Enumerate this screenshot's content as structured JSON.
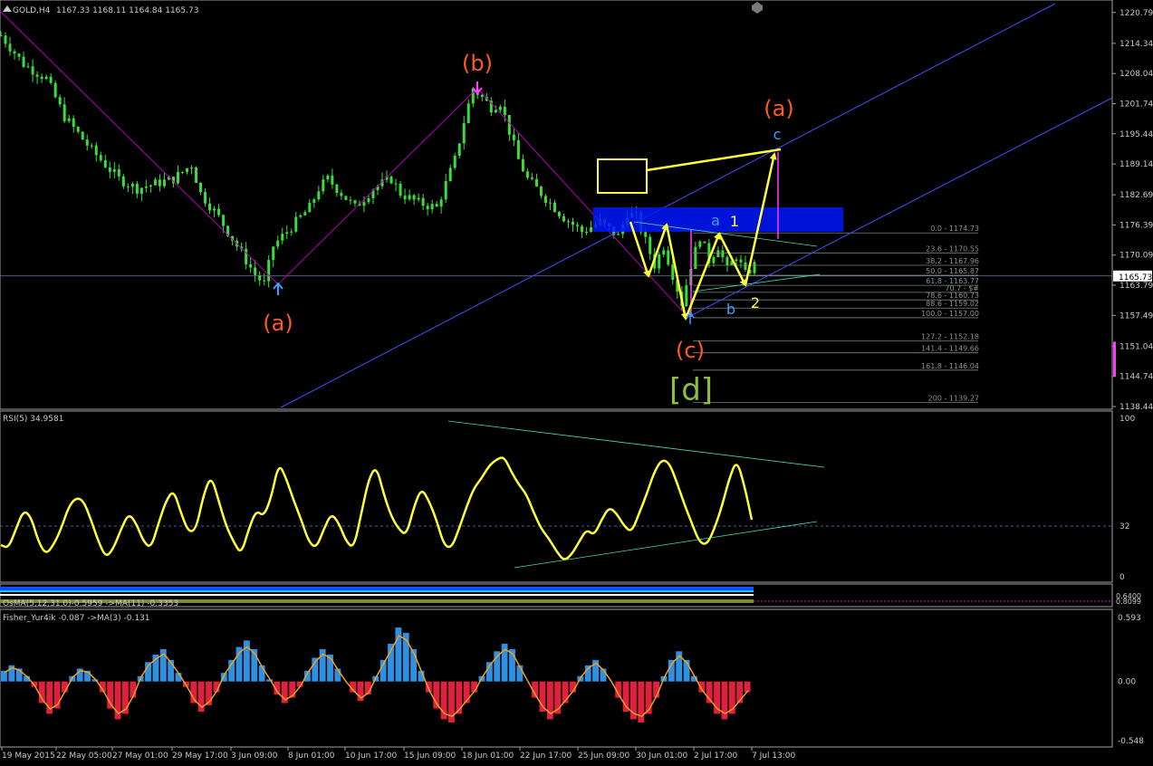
{
  "header": {
    "symbol": "GOLD,H4",
    "ohlc": "1167.33 1168.11 1164.84 1165.73",
    "close_icon": "up-triangle-icon"
  },
  "chart_data": {
    "type": "candlestick",
    "symbol": "GOLD",
    "timeframe": "H4",
    "ylim": [
      1138.44,
      1221.7
    ],
    "price_ticks": [
      "1220.79",
      "1214.34",
      "1208.04",
      "1201.74",
      "1195.44",
      "1189.14",
      "1182.69",
      "1176.39",
      "1170.09",
      "1163.79",
      "1157.49",
      "1151.04",
      "1144.74",
      "1138.44"
    ],
    "current_price": "1165.73",
    "date_ticks": [
      "19 May 2015",
      "22 May 05:00",
      "27 May 01:00",
      "29 May 17:00",
      "3 Jun 09:00",
      "8 Jun 01:00",
      "10 Jun 17:00",
      "15 Jun 09:00",
      "18 Jun 01:00",
      "22 Jun 17:00",
      "25 Jun 09:00",
      "30 Jun 01:00",
      "2 Jul 17:00",
      "7 Jul 13:00"
    ],
    "price_path": [
      [
        0,
        1216
      ],
      [
        5,
        1210
      ],
      [
        10,
        1207
      ],
      [
        14,
        1199
      ],
      [
        20,
        1192
      ],
      [
        26,
        1186
      ],
      [
        30,
        1184
      ],
      [
        34,
        1185
      ],
      [
        38,
        1186
      ],
      [
        42,
        1189
      ],
      [
        44,
        1183
      ],
      [
        48,
        1178
      ],
      [
        52,
        1172
      ],
      [
        56,
        1166
      ],
      [
        58,
        1164
      ],
      [
        60,
        1172
      ],
      [
        64,
        1176
      ],
      [
        68,
        1180
      ],
      [
        70,
        1184
      ],
      [
        72,
        1186
      ],
      [
        75,
        1183
      ],
      [
        78,
        1180
      ],
      [
        82,
        1184
      ],
      [
        86,
        1186
      ],
      [
        88,
        1183
      ],
      [
        92,
        1181
      ],
      [
        96,
        1180
      ],
      [
        98,
        1185
      ],
      [
        100,
        1190
      ],
      [
        102,
        1198
      ],
      [
        104,
        1205
      ],
      [
        106,
        1203
      ],
      [
        108,
        1201
      ],
      [
        110,
        1202
      ],
      [
        112,
        1196
      ],
      [
        114,
        1190
      ],
      [
        116,
        1186
      ],
      [
        120,
        1182
      ],
      [
        124,
        1178
      ],
      [
        128,
        1175
      ],
      [
        132,
        1177
      ],
      [
        136,
        1174
      ],
      [
        138,
        1179
      ],
      [
        140,
        1178
      ],
      [
        142,
        1173
      ],
      [
        144,
        1168
      ],
      [
        146,
        1172
      ],
      [
        148,
        1166
      ],
      [
        150,
        1160
      ],
      [
        152,
        1168
      ],
      [
        154,
        1174
      ],
      [
        156,
        1169
      ],
      [
        158,
        1172
      ],
      [
        160,
        1167
      ],
      [
        162,
        1170
      ],
      [
        164,
        1166
      ],
      [
        166,
        1168
      ]
    ],
    "wave_labels": [
      {
        "text": "(a)",
        "color": "#ff5a1e"
      },
      {
        "text": "(b)",
        "color": "#ff5a1e"
      },
      {
        "text": "(c)",
        "color": "#ff5a1e"
      },
      {
        "text": "(a)",
        "color": "#ff5a1e"
      },
      {
        "text": "[d]",
        "color": "#8fbf3a"
      },
      {
        "text": "a",
        "color": "#3ca0ff"
      },
      {
        "text": "b",
        "color": "#3ca0ff"
      },
      {
        "text": "c",
        "color": "#3ca0ff"
      },
      {
        "text": "1",
        "color": "#ffff40"
      },
      {
        "text": "2",
        "color": "#ffff40"
      }
    ],
    "fib_levels": [
      {
        "label": "0.0 - 1174.73"
      },
      {
        "label": "23.6 - 1170.55"
      },
      {
        "label": "38.2 - 1167.96"
      },
      {
        "label": "50.0 - 1165.87"
      },
      {
        "label": "61.8 - 1163.77"
      },
      {
        "label": "70.7 - $#"
      },
      {
        "label": "78.6 - 1160.73"
      },
      {
        "label": "88.6 - 1159.02"
      },
      {
        "label": "100.0 - 1157.00"
      },
      {
        "label": "127.2 - 1152.18"
      },
      {
        "label": "141.4 - 1149.66"
      },
      {
        "label": "161.8 - 1146.04"
      },
      {
        "label": "200 - 1139.27"
      }
    ],
    "rsi": {
      "title": "RSI(5) 34.9581",
      "ticks": [
        "100",
        "32",
        "0"
      ],
      "level": 32,
      "values": [
        20,
        18,
        30,
        42,
        38,
        22,
        14,
        20,
        30,
        44,
        50,
        48,
        36,
        22,
        12,
        18,
        30,
        40,
        34,
        22,
        18,
        34,
        48,
        55,
        40,
        28,
        30,
        52,
        64,
        48,
        32,
        22,
        14,
        30,
        42,
        38,
        50,
        72,
        62,
        48,
        36,
        22,
        18,
        30,
        40,
        34,
        22,
        18,
        40,
        62,
        70,
        52,
        38,
        30,
        26,
        44,
        56,
        48,
        36,
        20,
        18,
        30,
        44,
        56,
        62,
        70,
        74,
        76,
        66,
        58,
        52,
        40,
        30,
        24,
        16,
        10,
        14,
        22,
        30,
        26,
        36,
        44,
        40,
        32,
        28,
        40,
        52,
        66,
        74,
        72,
        60,
        46,
        34,
        22,
        20,
        30,
        44,
        62,
        74,
        58,
        36
      ]
    },
    "osma": {
      "title": "OsMA(5,12,31,0)-0.5959 ->MA(11) -0.3353",
      "ticks": [
        "0.8099",
        "0.6400"
      ]
    },
    "fisher": {
      "title": "Fisher_Yur4ik -0.087 ->MA(3) -0.131",
      "ticks": [
        "0.593",
        "0.00",
        "-0.548"
      ],
      "ylim": [
        -0.548,
        0.593
      ],
      "values": [
        0.1,
        0.15,
        0.12,
        0.05,
        -0.05,
        -0.2,
        -0.3,
        -0.25,
        -0.1,
        0.05,
        0.12,
        0.1,
        0.02,
        -0.1,
        -0.25,
        -0.35,
        -0.3,
        -0.15,
        0.05,
        0.18,
        0.25,
        0.3,
        0.2,
        0.08,
        -0.05,
        -0.2,
        -0.28,
        -0.22,
        -0.1,
        0.08,
        0.2,
        0.32,
        0.38,
        0.3,
        0.15,
        0.02,
        -0.12,
        -0.2,
        -0.15,
        -0.05,
        0.1,
        0.22,
        0.3,
        0.25,
        0.12,
        0,
        -0.1,
        -0.18,
        -0.12,
        0.05,
        0.2,
        0.35,
        0.5,
        0.45,
        0.3,
        0.1,
        -0.1,
        -0.25,
        -0.35,
        -0.38,
        -0.3,
        -0.2,
        -0.1,
        0.05,
        0.18,
        0.28,
        0.35,
        0.3,
        0.15,
        0,
        -0.15,
        -0.28,
        -0.35,
        -0.3,
        -0.2,
        -0.1,
        0.05,
        0.15,
        0.2,
        0.12,
        0,
        -0.15,
        -0.28,
        -0.35,
        -0.38,
        -0.3,
        -0.15,
        0.05,
        0.2,
        0.28,
        0.2,
        0.05,
        -0.1,
        -0.2,
        -0.3,
        -0.35,
        -0.3,
        -0.2,
        -0.1
      ]
    }
  },
  "colors": {
    "bull": "#3cdc3c",
    "rsi_line": "#ffff33",
    "fisher_pos": "#2f8fe0",
    "fisher_neg": "#e0203c",
    "fisher_ma": "#f0a020",
    "wave_path": "#b400b4",
    "channel": "#3c50ff",
    "arrow": "#ffff33",
    "zone": "#0018ff",
    "fib": "#788282",
    "trend": "#4cd9b0"
  }
}
